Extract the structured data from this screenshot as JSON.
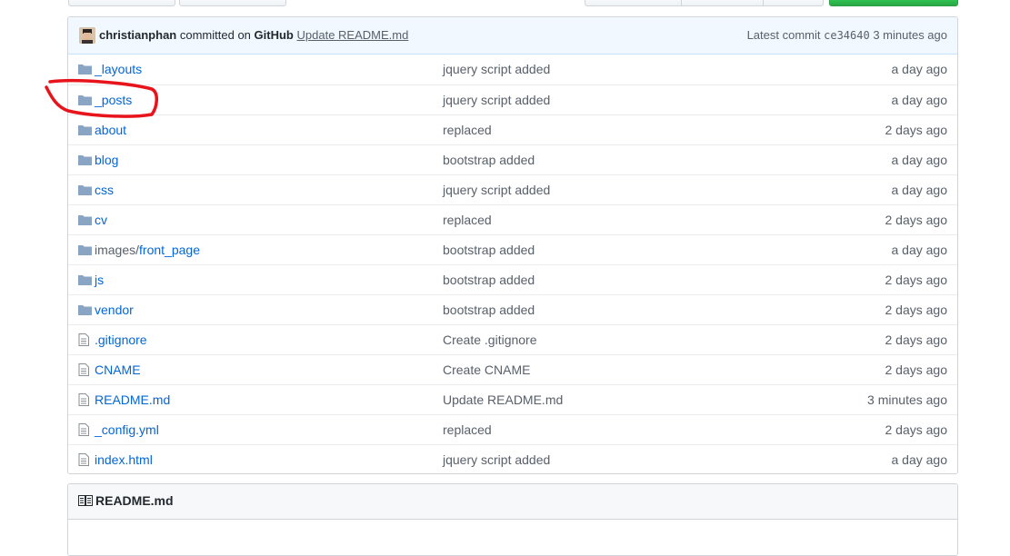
{
  "commit": {
    "author": "christianphan",
    "committed_on": "committed on",
    "platform": "GitHub",
    "message": "Update README.md",
    "latest_label": "Latest commit",
    "sha": "ce34640",
    "time": "3 minutes ago"
  },
  "files": [
    {
      "type": "folder-icon",
      "name": "_layouts",
      "message": "jquery script added",
      "age": "a day ago"
    },
    {
      "type": "folder-icon",
      "name": "_posts",
      "message": "jquery script added",
      "age": "a day ago"
    },
    {
      "type": "folder-icon",
      "name": "about",
      "message": "replaced",
      "age": "2 days ago"
    },
    {
      "type": "folder-icon",
      "name": "blog",
      "message": "bootstrap added",
      "age": "a day ago"
    },
    {
      "type": "folder-icon",
      "name": "css",
      "message": "jquery script added",
      "age": "a day ago"
    },
    {
      "type": "folder-icon",
      "name": "cv",
      "message": "replaced",
      "age": "2 days ago"
    },
    {
      "type": "folder-icon",
      "prefix": "images/",
      "name": "front_page",
      "message": "bootstrap added",
      "age": "a day ago"
    },
    {
      "type": "folder-icon",
      "name": "js",
      "message": "bootstrap added",
      "age": "2 days ago"
    },
    {
      "type": "folder-icon",
      "name": "vendor",
      "message": "bootstrap added",
      "age": "2 days ago"
    },
    {
      "type": "file-icon",
      "name": ".gitignore",
      "message": "Create .gitignore",
      "age": "2 days ago"
    },
    {
      "type": "file-icon",
      "name": "CNAME",
      "message": "Create CNAME",
      "age": "2 days ago"
    },
    {
      "type": "file-icon",
      "name": "README.md",
      "message": "Update README.md",
      "age": "3 minutes ago"
    },
    {
      "type": "file-icon",
      "name": "_config.yml",
      "message": "replaced",
      "age": "2 days ago"
    },
    {
      "type": "file-icon",
      "name": "index.html",
      "message": "jquery script added",
      "age": "a day ago"
    }
  ],
  "readme": {
    "title": "README.md",
    "icon": "book-icon"
  },
  "colors": {
    "link": "#0366d6",
    "muted": "#586069",
    "commit_bg": "#f1f8ff",
    "annotation": "#e8141b",
    "primary_button": "#28a745"
  }
}
